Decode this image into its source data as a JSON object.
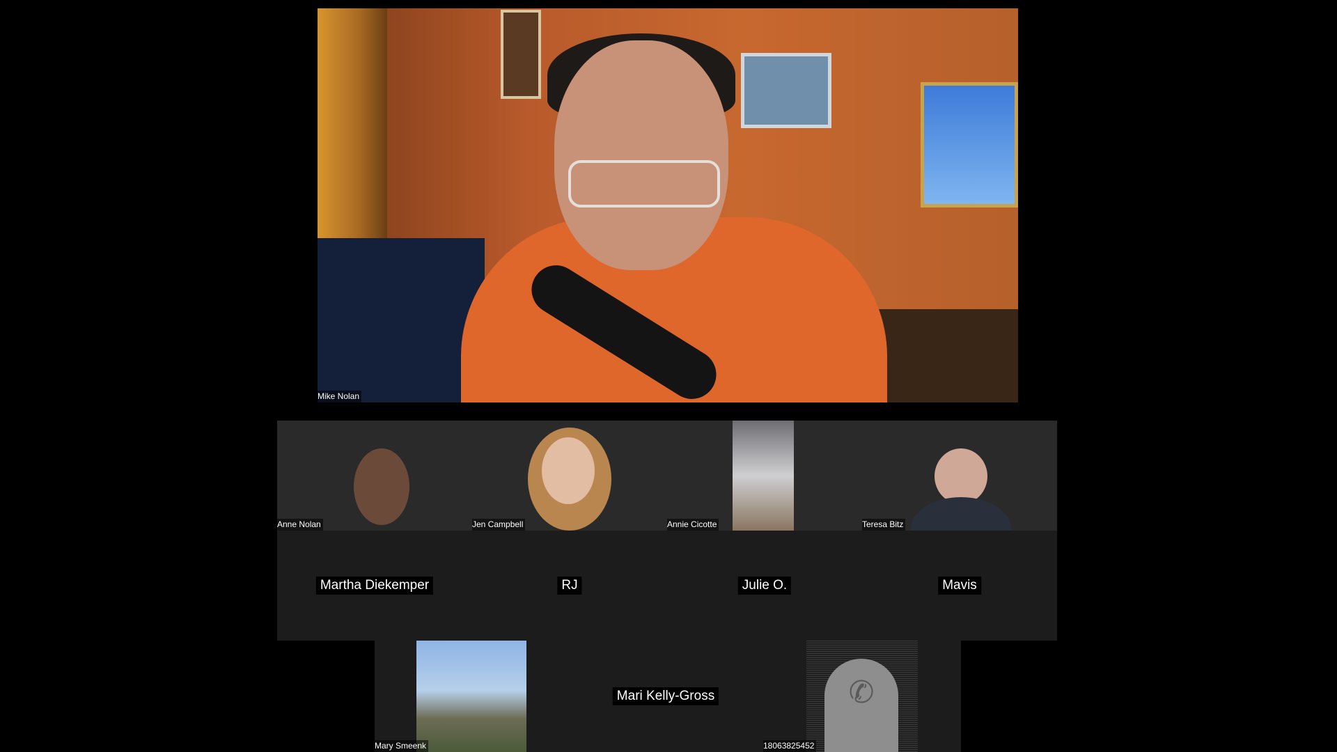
{
  "main_speaker": {
    "name": "Mike Nolan"
  },
  "gallery_row1": [
    {
      "name": "Anne Nolan",
      "video_on": true
    },
    {
      "name": "Jen Campbell",
      "video_on": true
    },
    {
      "name": "Annie Cicotte",
      "video_on": true
    },
    {
      "name": "Teresa Bitz",
      "video_on": true
    }
  ],
  "gallery_row2": [
    {
      "name": "Martha Diekemper",
      "video_on": false
    },
    {
      "name": "RJ",
      "video_on": false
    },
    {
      "name": "Julie O.",
      "video_on": false
    },
    {
      "name": "Mavis",
      "video_on": false
    }
  ],
  "gallery_row3": [
    {
      "name": "Mary Smeenk",
      "video_on": true
    },
    {
      "name": "Mari Kelly-Gross",
      "video_on": false
    },
    {
      "name": "18063825452",
      "video_on": false,
      "icon": "phone-icon"
    }
  ],
  "colors": {
    "background": "#000000",
    "tile_background": "#1c1c1c",
    "name_text": "#ffffff"
  }
}
